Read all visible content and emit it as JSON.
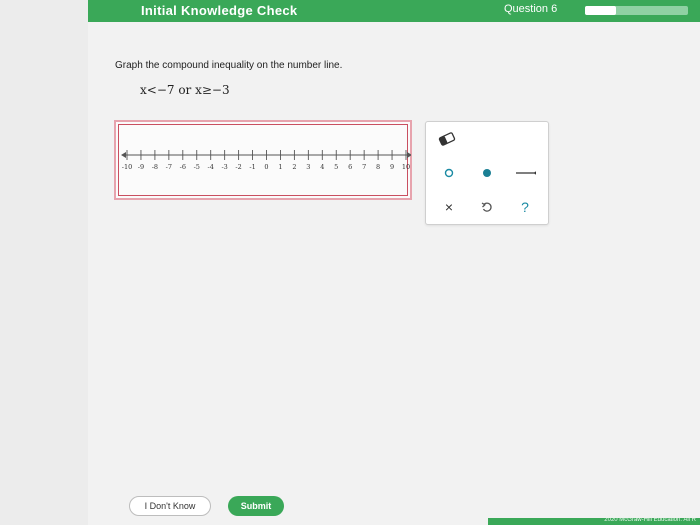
{
  "header": {
    "title": "Initial Knowledge Check",
    "question_label": "Question 6",
    "progress": 0.3,
    "accent_color": "#3aa858"
  },
  "question": {
    "prompt": "Graph the compound inequality on the number line.",
    "inequality": "x<−7 or x≥−3"
  },
  "number_line": {
    "min": -10,
    "max": 10,
    "tick_labels": [
      "-10",
      "-9",
      "-8",
      "-7",
      "-6",
      "-5",
      "-4",
      "-3",
      "-2",
      "-1",
      "0",
      "1",
      "2",
      "3",
      "4",
      "5",
      "6",
      "7",
      "8",
      "9",
      "10"
    ]
  },
  "tools": {
    "eraser": "eraser-icon",
    "open_point": "open-circle-icon",
    "closed_point": "closed-circle-icon",
    "segment": "segment-icon",
    "clear": "×",
    "undo": "undo-icon",
    "help": "?"
  },
  "buttons": {
    "dont_know": "I Don't Know",
    "submit": "Submit"
  },
  "footer": {
    "text": "2020 McGraw-Hill Education. All R"
  }
}
